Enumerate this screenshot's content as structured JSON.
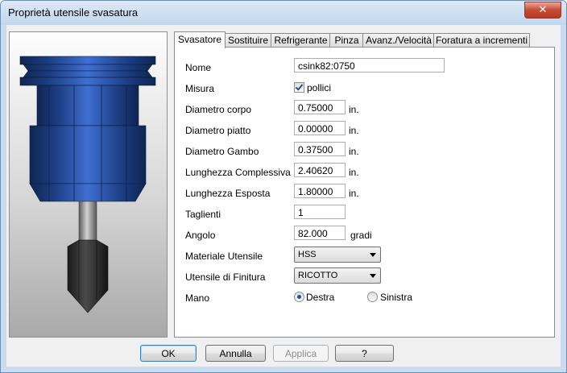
{
  "window": {
    "title": "Proprietà utensile svasatura",
    "close_glyph": "✕"
  },
  "tabs": [
    {
      "label": "Svasatore",
      "active": true
    },
    {
      "label": "Sostituire",
      "active": false
    },
    {
      "label": "Refrigerante",
      "active": false
    },
    {
      "label": "Pinza",
      "active": false
    },
    {
      "label": "Avanz./Velocità",
      "active": false
    },
    {
      "label": "Foratura a incrementi",
      "active": false
    }
  ],
  "form": {
    "name": {
      "label": "Nome",
      "value": "csink82:0750"
    },
    "measure": {
      "label": "Misura",
      "checkbox_label": "pollici",
      "checked": true
    },
    "body_diameter": {
      "label": "Diametro corpo",
      "value": "0.75000",
      "unit": "in."
    },
    "flat_diameter": {
      "label": "Diametro piatto",
      "value": "0.00000",
      "unit": "in."
    },
    "shank_diameter": {
      "label": "Diametro Gambo",
      "value": "0.37500",
      "unit": "in."
    },
    "overall_length": {
      "label": "Lunghezza Complessiva",
      "value": "2.40620",
      "unit": "in."
    },
    "exposed_length": {
      "label": "Lunghezza Esposta",
      "value": "1.80000",
      "unit": "in."
    },
    "flutes": {
      "label": "Taglienti",
      "value": "1"
    },
    "angle": {
      "label": "Angolo",
      "value": "82.000",
      "unit": "gradi"
    },
    "material": {
      "label": "Materiale Utensile",
      "value": "HSS"
    },
    "finishing_tool": {
      "label": "Utensile di Finitura",
      "value": "RICOTTO"
    },
    "hand": {
      "label": "Mano",
      "options": [
        "Destra",
        "Sinistra"
      ],
      "selected": "Destra"
    }
  },
  "buttons": {
    "ok": "OK",
    "cancel": "Annulla",
    "apply": "Applica",
    "help": "?"
  },
  "colors": {
    "tool_blue": "#2a4f9a",
    "tool_dark": "#122a5e",
    "shank_gray": "#8a8a8a",
    "tip_dark": "#2d2d2d",
    "accent": "#3c7fb1"
  }
}
